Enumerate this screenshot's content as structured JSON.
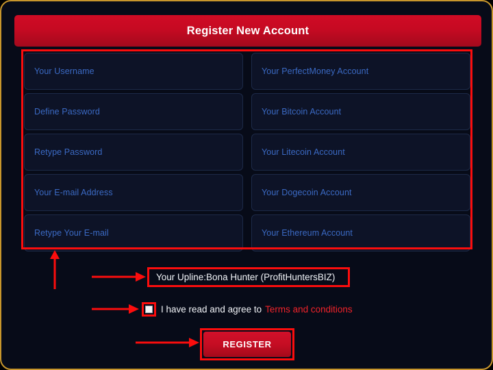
{
  "theme": {
    "page_background": "#070b18",
    "outer_border": "#c8962c",
    "accent_red": "#c60a22",
    "annotation_red": "#fb0d0d",
    "placeholder_blue": "#3b6ac4",
    "field_background": "#0d1327",
    "field_border": "#1d2a48",
    "text_white": "#f2f4f8",
    "link_red": "#f1232a"
  },
  "header": {
    "title": "Register New Account"
  },
  "form": {
    "left_column": [
      {
        "label": "Your Username",
        "value": "",
        "name": "username-field"
      },
      {
        "label": "Define Password",
        "value": "",
        "name": "define-password-field"
      },
      {
        "label": "Retype Password",
        "value": "",
        "name": "retype-password-field"
      },
      {
        "label": "Your E-mail Address",
        "value": "",
        "name": "email-field"
      },
      {
        "label": "Retype Your E-mail",
        "value": "",
        "name": "retype-email-field"
      }
    ],
    "right_column": [
      {
        "label": "Your PerfectMoney Account",
        "value": "",
        "name": "perfectmoney-field"
      },
      {
        "label": "Your Bitcoin Account",
        "value": "",
        "name": "bitcoin-field"
      },
      {
        "label": "Your Litecoin Account",
        "value": "",
        "name": "litecoin-field"
      },
      {
        "label": "Your Dogecoin Account",
        "value": "",
        "name": "dogecoin-field"
      },
      {
        "label": "Your Ethereum Account",
        "value": "",
        "name": "ethereum-field"
      }
    ]
  },
  "upline": {
    "text": "Your Upline:Bona Hunter (ProfitHuntersBIZ)"
  },
  "terms": {
    "checkbox_checked": false,
    "text": "I have read and agree to",
    "link_label": "Terms and conditions"
  },
  "register": {
    "label": "REGISTER"
  },
  "annotations": {
    "fields_box": "red-box-around-all-input-fields",
    "upline_box": "red-box-around-upline-text",
    "checkbox_box": "red-box-around-agree-checkbox",
    "register_box": "red-box-around-register-button",
    "arrow_up_to_fields": "arrow-up-icon",
    "arrow_to_upline": "arrow-right-icon",
    "arrow_to_checkbox": "arrow-right-icon",
    "arrow_to_register": "arrow-right-icon"
  }
}
